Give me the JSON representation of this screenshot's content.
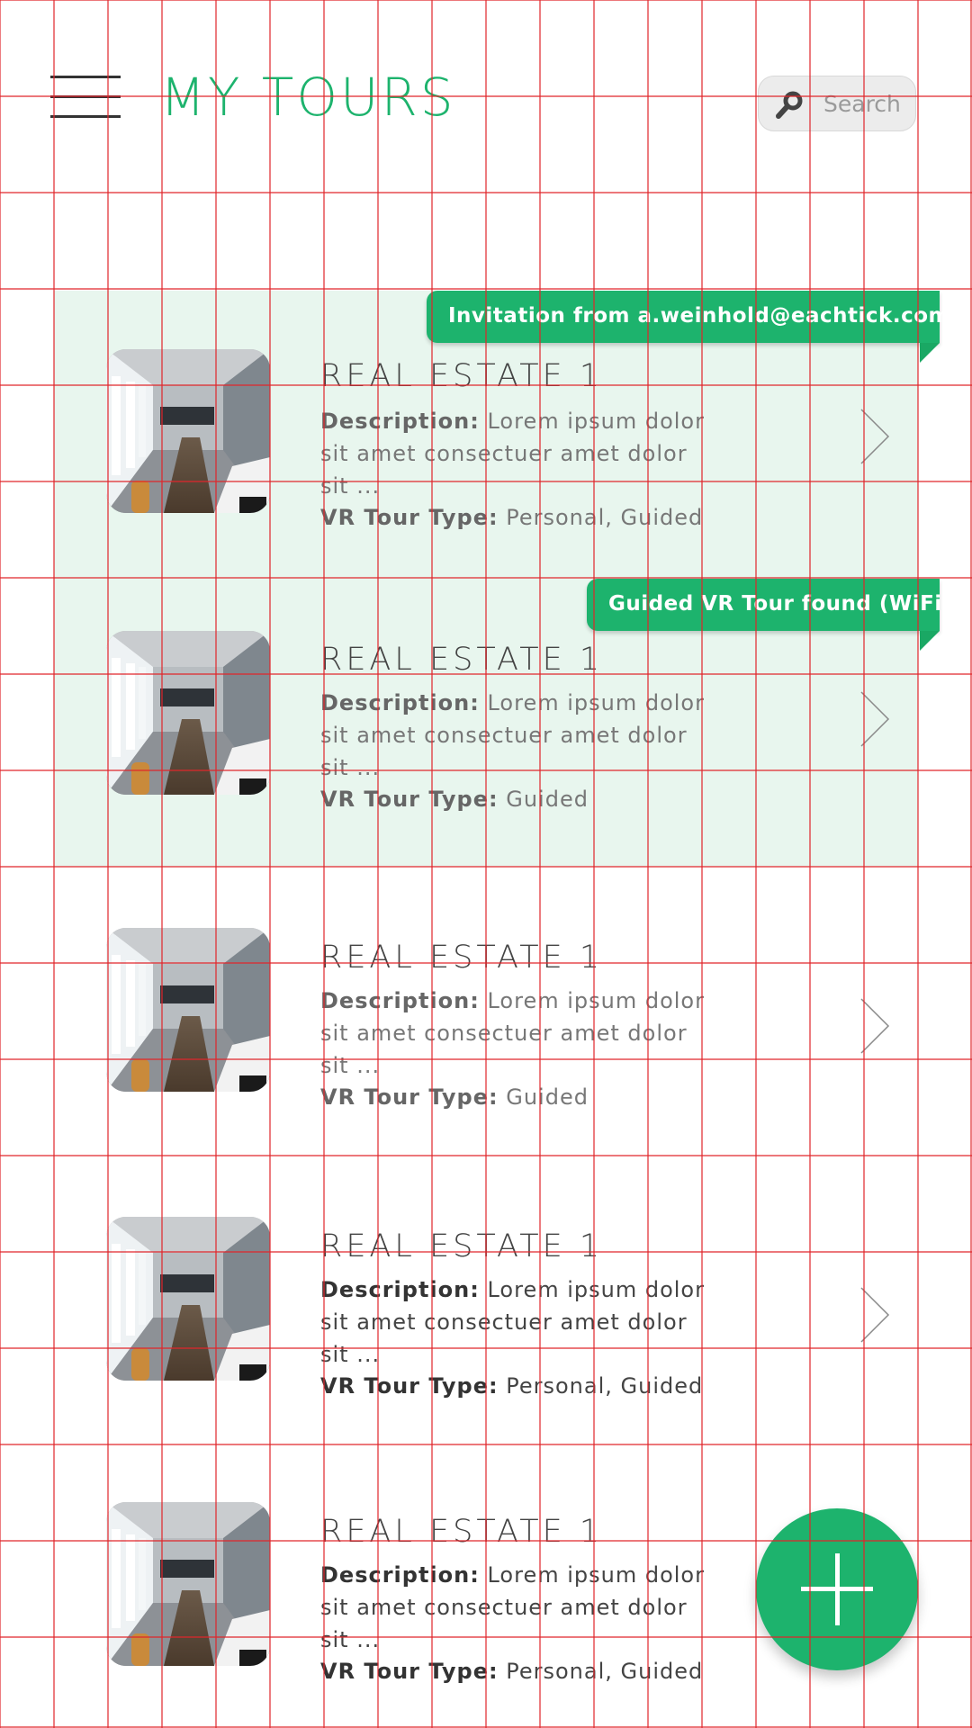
{
  "header": {
    "title": "MY TOURS",
    "search_placeholder": "Search"
  },
  "colors": {
    "accent": "#1db36d",
    "highlight_bg": "#e8f6ee",
    "grid_line": "#e0262b"
  },
  "tours": [
    {
      "title": "REAL ESTATE 1",
      "description_label": "Description:",
      "description": "Lorem ipsum dolor sit amet consectuer amet dolor sit ...",
      "type_label": "VR Tour Type:",
      "type": "Personal, Guided",
      "badge": "Invitation from a.weinhold@eachtick.com",
      "highlighted": true
    },
    {
      "title": "REAL ESTATE 1",
      "description_label": "Description:",
      "description": "Lorem ipsum dolor sit amet consectuer amet dolor sit ...",
      "type_label": "VR Tour Type:",
      "type": "Guided",
      "badge": "Guided VR Tour found (WiFi)",
      "highlighted": true
    },
    {
      "title": "REAL ESTATE 1",
      "description_label": "Description:",
      "description": "Lorem ipsum dolor sit amet consectuer amet dolor sit ...",
      "type_label": "VR Tour Type:",
      "type": "Guided",
      "highlighted": false
    },
    {
      "title": "REAL ESTATE 1",
      "description_label": "Description:",
      "description": "Lorem ipsum dolor sit amet consectuer amet dolor sit ...",
      "type_label": "VR Tour Type:",
      "type": "Personal, Guided",
      "highlighted": false
    },
    {
      "title": "REAL ESTATE 1",
      "description_label": "Description:",
      "description": "Lorem ipsum dolor sit amet consectuer amet dolor sit ...",
      "type_label": "VR Tour Type:",
      "type": "Personal, Guided",
      "highlighted": false
    }
  ],
  "icons": {
    "menu": "hamburger-menu-icon",
    "search": "search-icon",
    "chevron": "chevron-right-icon",
    "add": "plus-icon"
  }
}
